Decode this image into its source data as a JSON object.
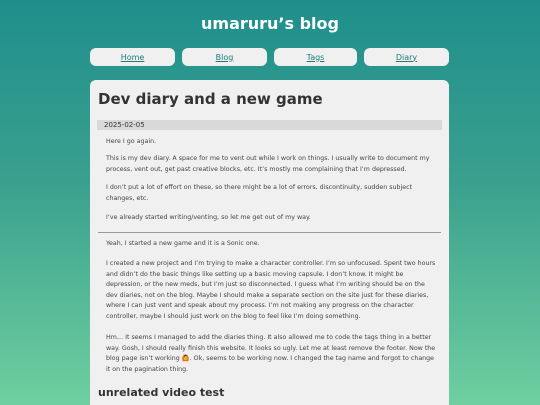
{
  "site": {
    "title": "umaruru’s blog"
  },
  "nav": {
    "items": [
      "Home",
      "Blog",
      "Tags",
      "Diary"
    ]
  },
  "post": {
    "title": "Dev diary and a new game",
    "date": "2025-02-05",
    "intro": [
      "Here I go again.",
      "This is my dev diary. A space for me to vent out while I work on things. I usually write to document my process, vent out, get past creative blocks, etc. It’s mostly me complaining that I’m depressed.",
      "I don’t put a lot of effort on these, so there might be a lot of errors, discontinuity, sudden subject changes, etc.",
      "I’ve already started writing/venting, so let me get out of my way."
    ],
    "body": [
      "Yeah, I started a new game and it is a Sonic one.",
      "I created a new project and I’m trying to make a character controller. I’m so unfocused. Spent two hours and didn’t do the basic things like setting up a basic moving capsule. I don’t know. It might be depression, or the new meds, but I’m just so disconnected. I guess what I’m writing should be on the dev diaries, not on the blog. Maybe I should make a separate section on the site just for these diaries, where I can just vent and speak about my process. I’m not making any progress on the character controller, maybe I should just work on the blog to feel like I’m doing something.",
      "Hm… It seems I managed to add the diaries thing. It also allowed me to code the tags thing in a better way. Gosh, I should really finish this website. It looks so ugly. Let me at least remove the footer. Now the blog page isn’t working 🙆. Ok, seems to be working now. I changed the tag name and forgot to change it on the pagination thing."
    ],
    "section_title": "unrelated video test"
  }
}
